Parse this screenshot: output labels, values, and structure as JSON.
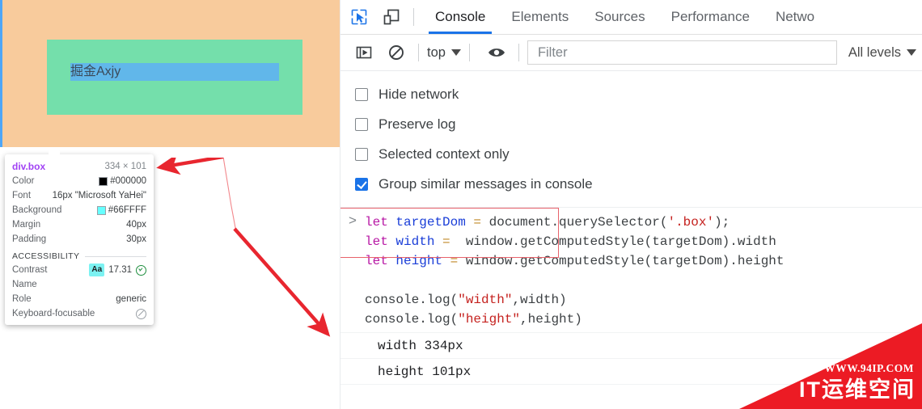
{
  "page": {
    "box_text": "掘金Axjy",
    "outer_bg": "#f8cb9c",
    "inner_bg": "#74dfab",
    "selection_bg": "#61b7ea"
  },
  "inspect_tooltip": {
    "selector": "div.box",
    "dimensions": "334 × 101",
    "rows": [
      {
        "key": "Color",
        "value": "#000000",
        "swatch": "#000000"
      },
      {
        "key": "Font",
        "value": "16px \"Microsoft YaHei\"",
        "swatch": ""
      },
      {
        "key": "Background",
        "value": "#66FFFF",
        "swatch": "#66FFFF"
      },
      {
        "key": "Margin",
        "value": "40px",
        "swatch": ""
      },
      {
        "key": "Padding",
        "value": "30px",
        "swatch": ""
      }
    ],
    "accessibility_header": "ACCESSIBILITY",
    "a11y_rows": [
      {
        "key": "Contrast",
        "badge": "Aa",
        "value": "17.31",
        "icon": "check-circle-icon"
      },
      {
        "key": "Name",
        "badge": "",
        "value": "",
        "icon": ""
      },
      {
        "key": "Role",
        "badge": "",
        "value": "generic",
        "icon": ""
      },
      {
        "key": "Keyboard-focusable",
        "badge": "",
        "value": "",
        "icon": "not-allowed-icon"
      }
    ]
  },
  "devtools": {
    "icons": {
      "inspect": "inspect-element-icon",
      "device": "device-toolbar-icon"
    },
    "tabs": [
      {
        "label": "Console",
        "active": true
      },
      {
        "label": "Elements",
        "active": false
      },
      {
        "label": "Sources",
        "active": false
      },
      {
        "label": "Performance",
        "active": false
      },
      {
        "label": "Netwo",
        "active": false
      }
    ],
    "toolbar": {
      "execute_icon": "run-script-icon",
      "clear_icon": "clear-console-icon",
      "context": "top",
      "eye_icon": "live-expression-icon",
      "filter_placeholder": "Filter",
      "levels": "All levels"
    },
    "settings": [
      {
        "label": "Hide network",
        "checked": false
      },
      {
        "label": "Preserve log",
        "checked": false
      },
      {
        "label": "Selected context only",
        "checked": false
      },
      {
        "label": "Group similar messages in console",
        "checked": true
      }
    ],
    "console": {
      "prompt": ">",
      "code_lines": [
        [
          {
            "t": "let ",
            "c": "kw"
          },
          {
            "t": "targetDom ",
            "c": "var"
          },
          {
            "t": "= ",
            "c": "op"
          },
          {
            "t": "document.querySelector(",
            "c": ""
          },
          {
            "t": "'.box'",
            "c": "str"
          },
          {
            "t": ");",
            "c": ""
          }
        ],
        [
          {
            "t": "let ",
            "c": "kw"
          },
          {
            "t": "width ",
            "c": "var"
          },
          {
            "t": "= ",
            "c": "op"
          },
          {
            "t": " window.getComputedStyle(targetDom).width",
            "c": ""
          }
        ],
        [
          {
            "t": "let ",
            "c": "kw"
          },
          {
            "t": "height ",
            "c": "var"
          },
          {
            "t": "= ",
            "c": "op"
          },
          {
            "t": "window.getComputedStyle(targetDom).height",
            "c": ""
          }
        ],
        [],
        [
          {
            "t": "console.log(",
            "c": ""
          },
          {
            "t": "\"width\"",
            "c": "str"
          },
          {
            "t": ",width)",
            "c": ""
          }
        ],
        [
          {
            "t": "console.log(",
            "c": ""
          },
          {
            "t": "\"height\"",
            "c": "str"
          },
          {
            "t": ",height)",
            "c": ""
          }
        ]
      ],
      "output_rows": [
        "width 334px",
        "height 101px"
      ],
      "highlight_color": "#e8626b"
    }
  },
  "annotation": {
    "arrow_color": "#e8262f"
  },
  "watermark": {
    "url": "WWW.94IP.COM",
    "name": "IT运维空间",
    "bg": "#ec1b24"
  }
}
